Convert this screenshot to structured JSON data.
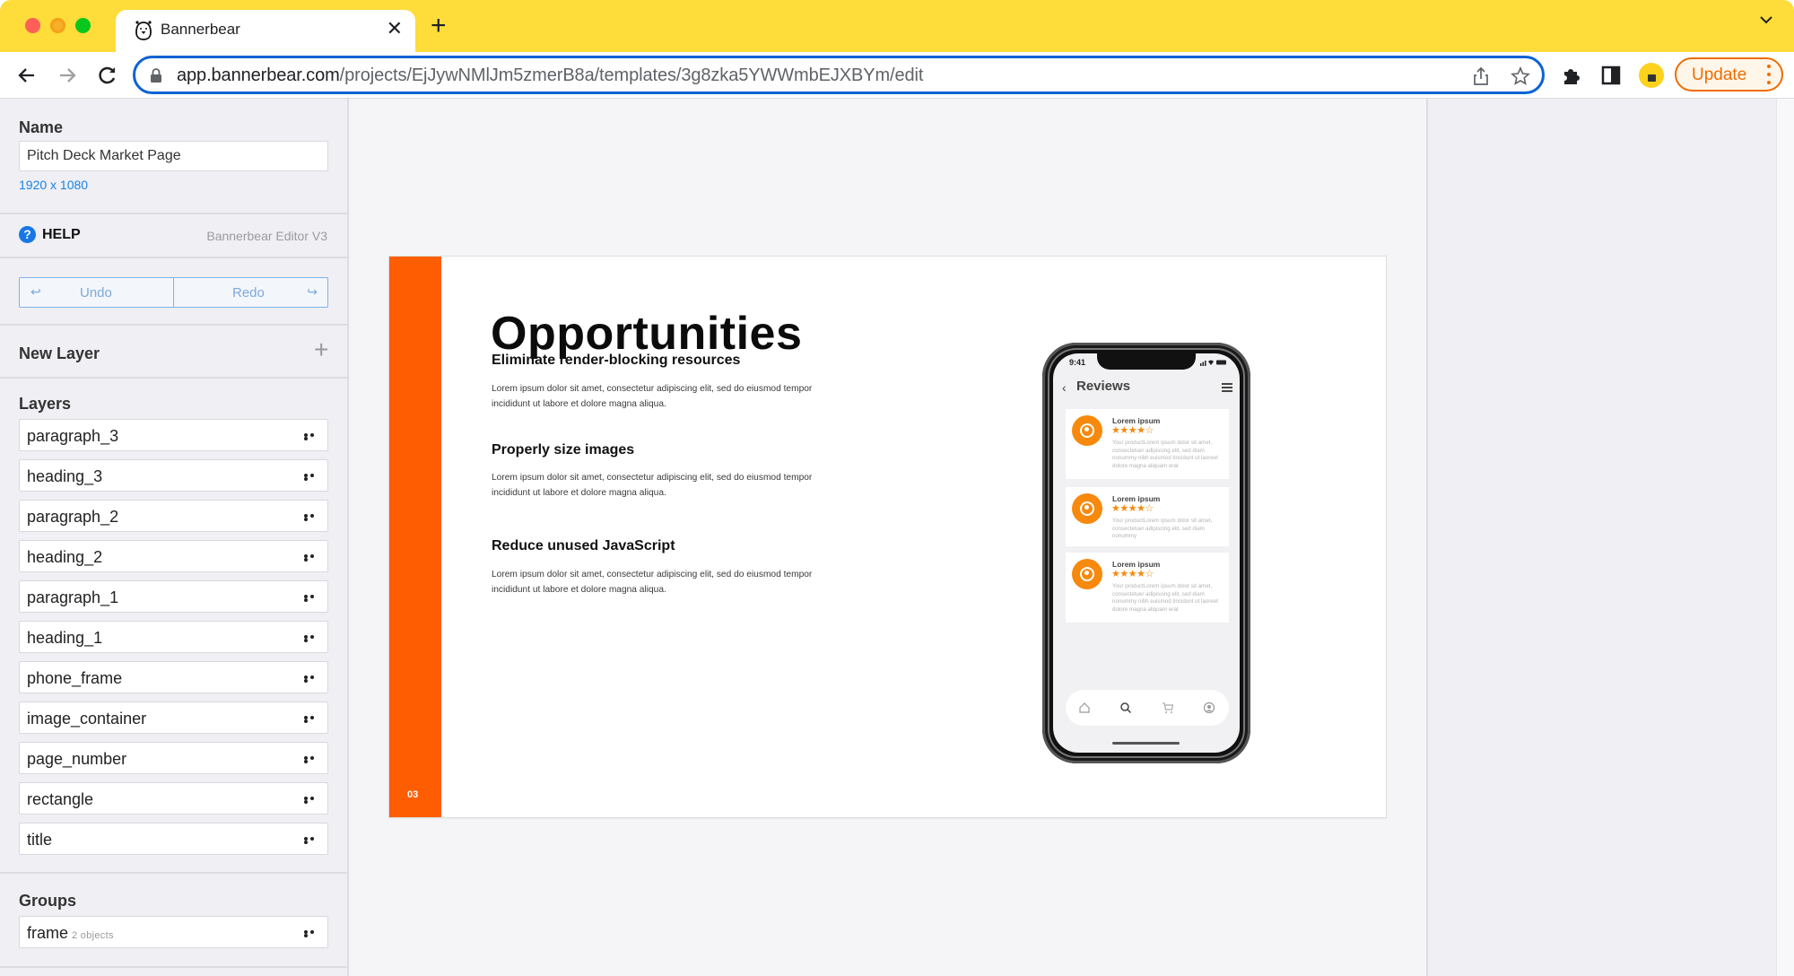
{
  "browser": {
    "tab_title": "Bannerbear",
    "url_host": "app.bannerbear.com",
    "url_path": "/projects/EjJywNMlJm5zmerB8a/templates/3g8zka5YWWmbEJXBYm/edit",
    "update_label": "Update",
    "colors": {
      "tabstrip": "#fedc3a",
      "omnibox_border": "#0b63d6",
      "update": "#ef6c00"
    }
  },
  "sidebar": {
    "name_label": "Name",
    "name_value": "Pitch Deck Market Page",
    "dimensions": "1920 x 1080",
    "help_label": "HELP",
    "editor_version": "Bannerbear Editor V3",
    "undo_label": "Undo",
    "redo_label": "Redo",
    "new_layer_label": "New Layer",
    "layers_label": "Layers",
    "layers": [
      {
        "name": "paragraph_3"
      },
      {
        "name": "heading_3"
      },
      {
        "name": "paragraph_2"
      },
      {
        "name": "heading_2"
      },
      {
        "name": "paragraph_1"
      },
      {
        "name": "heading_1"
      },
      {
        "name": "phone_frame"
      },
      {
        "name": "image_container"
      },
      {
        "name": "page_number"
      },
      {
        "name": "rectangle"
      },
      {
        "name": "title"
      }
    ],
    "groups_label": "Groups",
    "groups": [
      {
        "name": "frame",
        "count": "2 objects"
      }
    ]
  },
  "slide": {
    "accent_color": "#ff5d01",
    "title": "Opportunities",
    "page_number": "03",
    "sections": [
      {
        "heading": "Eliminate render-blocking resources",
        "paragraph": "Lorem ipsum dolor sit amet, consectetur adipiscing elit, sed do eiusmod tempor incididunt ut labore et dolore magna aliqua."
      },
      {
        "heading": "Properly size images",
        "paragraph": "Lorem ipsum dolor sit amet, consectetur adipiscing elit, sed do eiusmod tempor incididunt ut labore et dolore magna aliqua."
      },
      {
        "heading": "Reduce unused JavaScript",
        "paragraph": "Lorem ipsum dolor sit amet, consectetur adipiscing elit, sed do eiusmod tempor incididunt ut labore et dolore magna aliqua."
      }
    ],
    "phone": {
      "time": "9:41",
      "screen_title": "Reviews",
      "reviews": [
        {
          "name": "Lorem ipsum",
          "rating": 4,
          "max_rating": 5,
          "text": "Your productLorem ipsum dolor sit amet, consectetuer adipiscing elit, sed diam nonummy nibh euismod tincidunt ut laoreet dolore magna aliquam erat"
        },
        {
          "name": "Lorem ipsum",
          "rating": 4,
          "max_rating": 5,
          "text": "Your productLorem ipsum dolor sit amet, consectetuer adipiscing elit, sed diam nonummy"
        },
        {
          "name": "Lorem ipsum",
          "rating": 4,
          "max_rating": 5,
          "text": "Your productLorem ipsum dolor sit amet, consectetuer adipiscing elit, sed diam nonummy nibh euismod tincidunt ut laoreet dolore magna aliquam erat"
        }
      ],
      "tabbar_icons": [
        "home-icon",
        "search-icon",
        "cart-icon",
        "profile-icon"
      ]
    }
  }
}
